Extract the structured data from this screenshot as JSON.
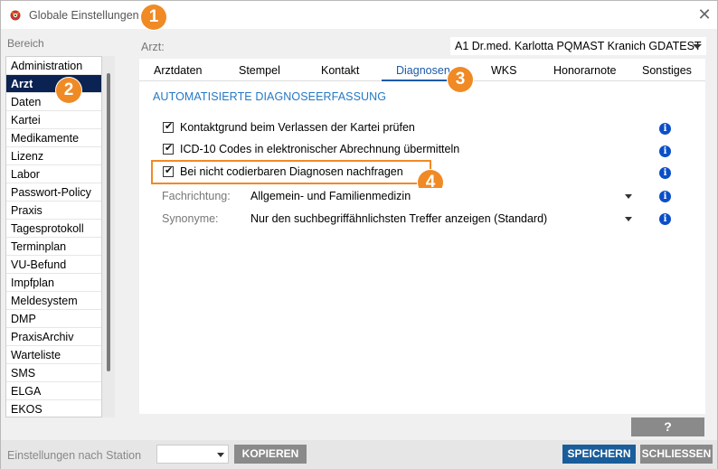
{
  "window": {
    "title": "Globale Einstellungen"
  },
  "callouts": [
    "1",
    "2",
    "3",
    "4"
  ],
  "sidebar": {
    "label": "Bereich",
    "items": [
      "Administration",
      "Arzt",
      "Daten",
      "Kartei",
      "Medikamente",
      "Lizenz",
      "Labor",
      "Passwort-Policy",
      "Praxis",
      "Tagesprotokoll",
      "Terminplan",
      "VU-Befund",
      "Impfplan",
      "Meldesystem",
      "DMP",
      "PraxisArchiv",
      "Warteliste",
      "SMS",
      "ELGA",
      "EKOS"
    ],
    "active": "Arzt"
  },
  "arzt": {
    "label": "Arzt:",
    "value": "A1 Dr.med. Karlotta PQMAST Kranich GDATEST"
  },
  "tabs": [
    "Arztdaten",
    "Stempel",
    "Kontakt",
    "Diagnosen",
    "WKS",
    "Honorarnote",
    "Sonstiges"
  ],
  "active_tab": "Diagnosen",
  "section": {
    "title": "AUTOMATISIERTE DIAGNOSEERFASSUNG",
    "options": [
      {
        "label": "Kontaktgrund beim Verlassen der Kartei prüfen",
        "checked": true
      },
      {
        "label": "ICD-10 Codes in elektronischer Abrechnung übermitteln",
        "checked": true
      },
      {
        "label": "Bei nicht codierbaren Diagnosen nachfragen",
        "checked": true
      }
    ],
    "fachrichtung": {
      "label": "Fachrichtung:",
      "value": "Allgemein- und Familienmedizin"
    },
    "synonyme": {
      "label": "Synonyme:",
      "value": "Nur den suchbegriffähnlichsten Treffer anzeigen (Standard)"
    }
  },
  "help_button": "?",
  "footer": {
    "station_label": "Einstellungen nach Station",
    "station_value": "",
    "kopieren": "KOPIEREN",
    "speichern": "SPEICHERN",
    "schliessen": "SCHLIESSEN"
  },
  "colors": {
    "accent_orange": "#f08a24",
    "active_navy": "#0b2352",
    "link_blue": "#1a5aa8",
    "info_blue": "#0a4fc8",
    "save_blue": "#1a5d9b"
  },
  "icons": [
    "app-icon",
    "close-icon",
    "info-icon",
    "chevron-down-icon"
  ]
}
